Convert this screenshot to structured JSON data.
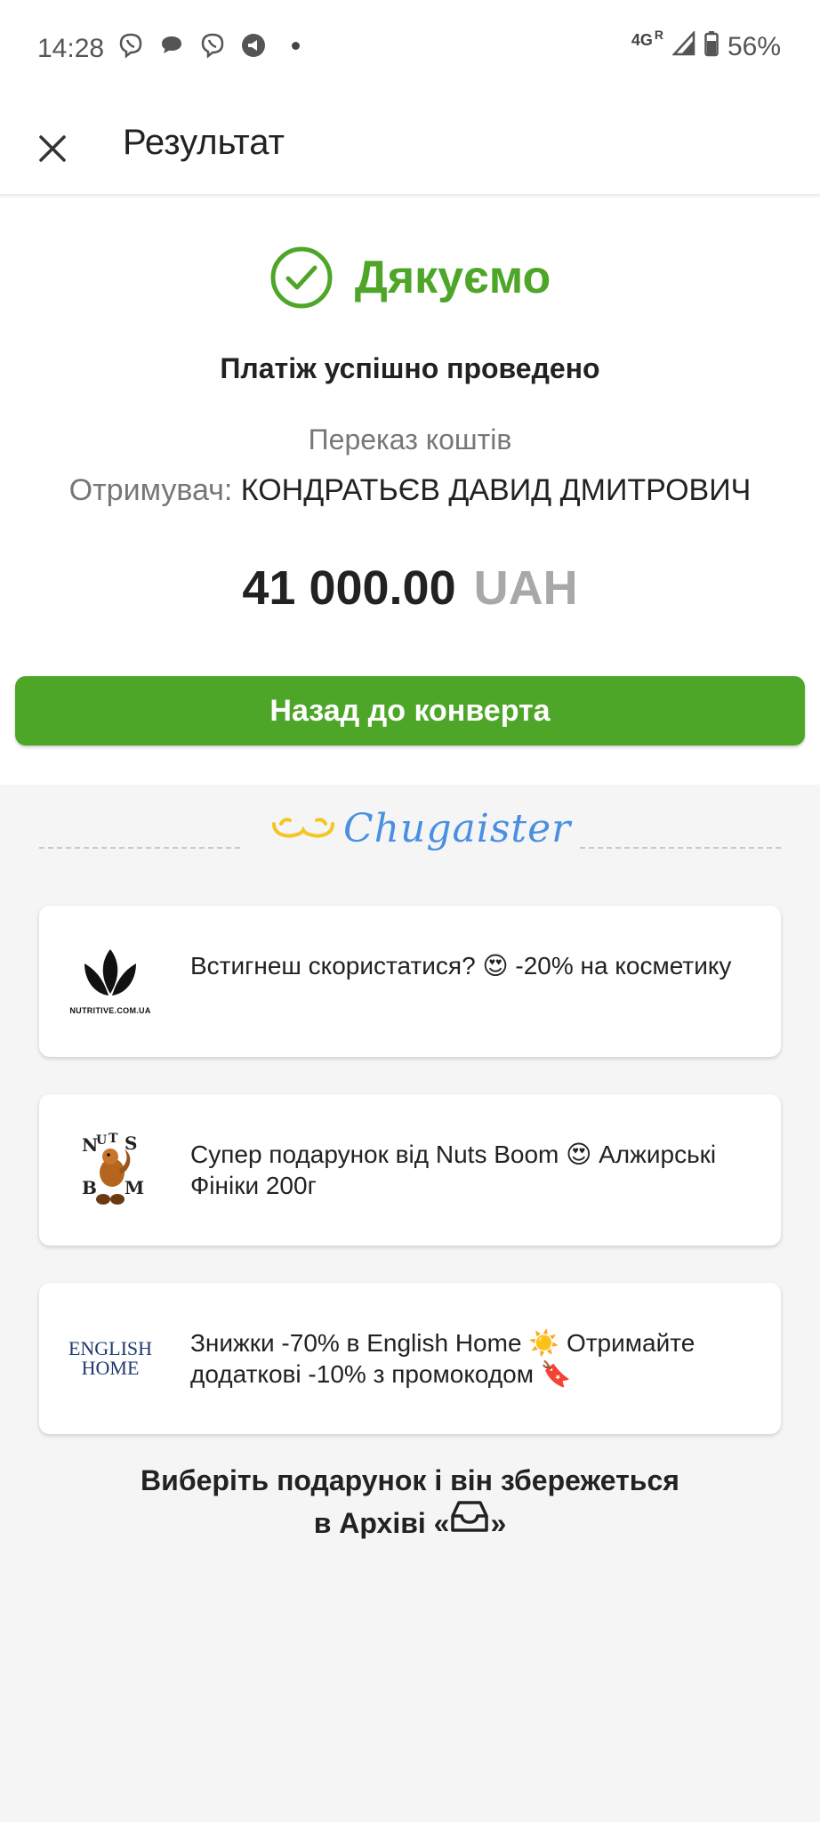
{
  "status_bar": {
    "time": "14:28",
    "network": "4G",
    "roaming": "R",
    "battery": "56%"
  },
  "app_bar": {
    "title": "Результат"
  },
  "result": {
    "thanks": "Дякуємо",
    "success": "Платіж успішно проведено",
    "transfer_type": "Переказ коштів",
    "recipient_label": "Отримувач:",
    "recipient_name": "КОНДРАТЬЄВ ДАВИД ДМИТРОВИЧ",
    "amount": "41 000.00",
    "currency": "UAH",
    "back_button": "Назад до конверта",
    "accent_color": "#4ea629"
  },
  "chugaister": {
    "brand": "Chugaister",
    "offers": [
      {
        "logo_caption": "NUTRITIVE.COM.UA",
        "text": "Встигнеш скористатися? 😍 -20% на косметику"
      },
      {
        "logo_caption": "NUTS BOOM",
        "text": "Супер подарунок від Nuts Boom 😍 Алжирські Фініки 200г"
      },
      {
        "logo_caption": "ENGLISH HOME",
        "text": "Знижки -70% в English Home ☀️ Отримайте додаткові -10% з промокодом 🔖"
      }
    ],
    "archive_note_line1": "Виберіть подарунок і він збережеться",
    "archive_note_prefix": "в Архіві «",
    "archive_note_suffix": "»"
  }
}
